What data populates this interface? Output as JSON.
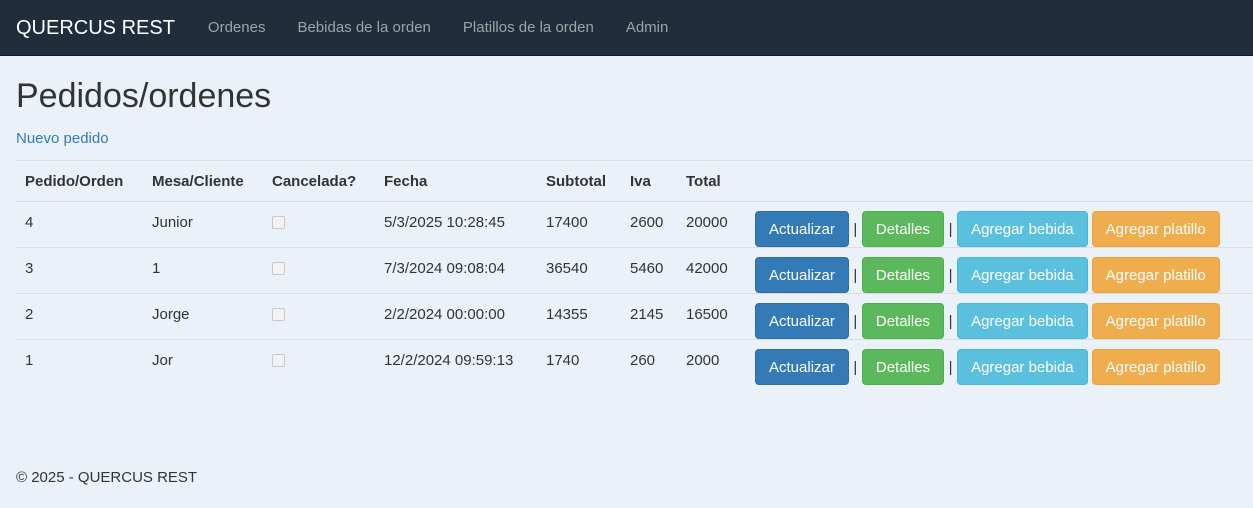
{
  "nav": {
    "brand": "QUERCUS REST",
    "links": [
      "Ordenes",
      "Bebidas de la orden",
      "Platillos de la orden",
      "Admin"
    ]
  },
  "page": {
    "title": "Pedidos/ordenes",
    "new_link": "Nuevo pedido"
  },
  "table": {
    "headers": [
      "Pedido/Orden",
      "Mesa/Cliente",
      "Cancelada?",
      "Fecha",
      "Subtotal",
      "Iva",
      "Total"
    ],
    "rows": [
      {
        "id": "4",
        "cliente": "Junior",
        "cancelada": false,
        "fecha": "5/3/2025 10:28:45",
        "subtotal": "17400",
        "iva": "2600",
        "total": "20000"
      },
      {
        "id": "3",
        "cliente": "1",
        "cancelada": false,
        "fecha": "7/3/2024 09:08:04",
        "subtotal": "36540",
        "iva": "5460",
        "total": "42000"
      },
      {
        "id": "2",
        "cliente": "Jorge",
        "cancelada": false,
        "fecha": "2/2/2024 00:00:00",
        "subtotal": "14355",
        "iva": "2145",
        "total": "16500"
      },
      {
        "id": "1",
        "cliente": "Jor",
        "cancelada": false,
        "fecha": "12/2/2024 09:59:13",
        "subtotal": "1740",
        "iva": "260",
        "total": "2000"
      }
    ],
    "actions": {
      "update": "Actualizar",
      "details": "Detalles",
      "add_drink": "Agregar bebida",
      "add_dish": "Agregar platillo",
      "separator": "|"
    }
  },
  "footer": {
    "text": "© 2025 - QUERCUS REST"
  },
  "colors": {
    "navbar": "#202d3b",
    "background": "#ebf1f8",
    "primary": "#337ab7",
    "success": "#5cb85c",
    "info": "#5bc0de",
    "warning": "#f0ad4e"
  }
}
